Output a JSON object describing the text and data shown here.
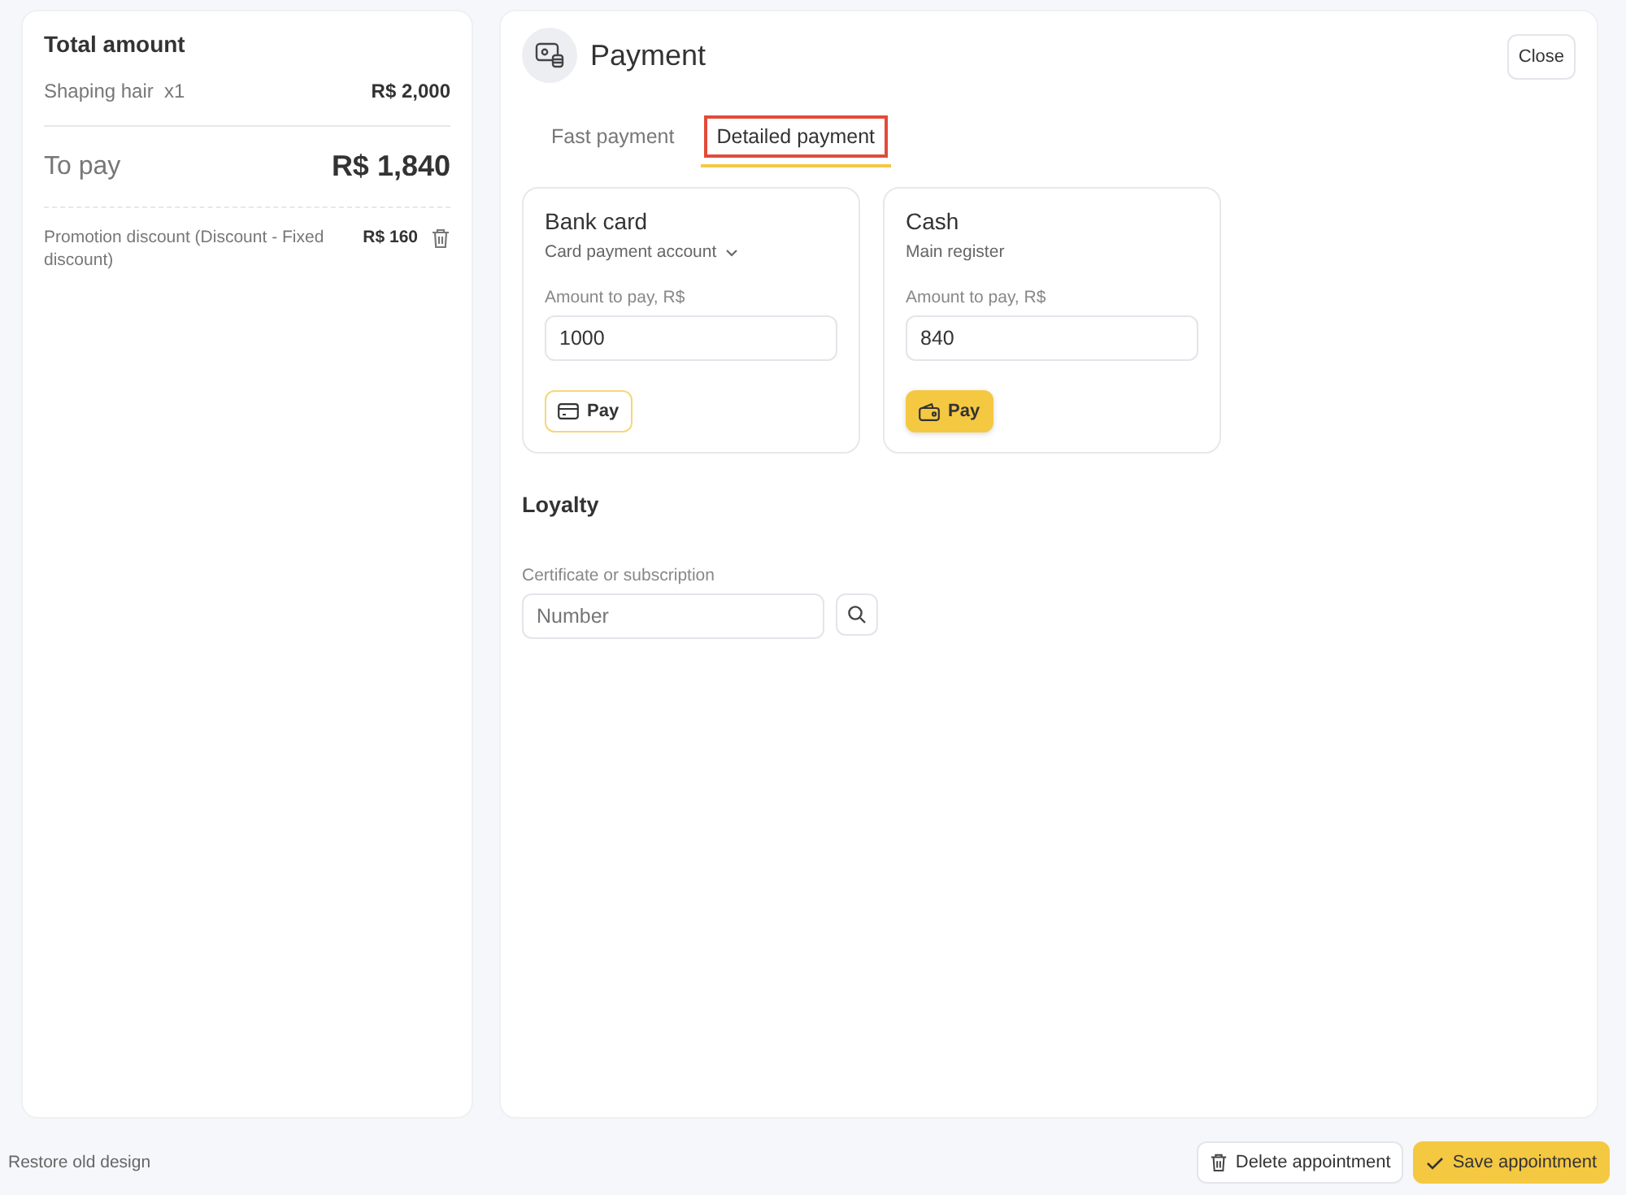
{
  "summary": {
    "title": "Total amount",
    "items": [
      {
        "name": "Shaping hair  x1",
        "amount": "R$ 2,000"
      }
    ],
    "to_pay_label": "To pay",
    "to_pay_amount": "R$ 1,840",
    "discounts": [
      {
        "name": "Promotion discount (Discount - Fixed discount)",
        "amount": "R$ 160"
      }
    ]
  },
  "payment": {
    "title": "Payment",
    "close": "Close",
    "tabs": [
      {
        "label": "Fast payment",
        "selected": false,
        "highlighted": false
      },
      {
        "label": "Detailed payment",
        "selected": true,
        "highlighted": true
      }
    ],
    "methods": [
      {
        "kind": "card",
        "title": "Bank card",
        "account": "Card payment account",
        "dropdown": true,
        "amount_label": "Amount to pay, R$",
        "amount": "1000",
        "button": "Pay",
        "primary": false
      },
      {
        "kind": "cash",
        "title": "Cash",
        "account": "Main register",
        "dropdown": false,
        "amount_label": "Amount to pay, R$",
        "amount": "840",
        "button": "Pay",
        "primary": true
      }
    ],
    "loyalty": {
      "title": "Loyalty",
      "label": "Certificate or subscription",
      "placeholder": "Number"
    }
  },
  "footer": {
    "restore": "Restore old design",
    "delete": "Delete appointment",
    "save": "Save appointment"
  }
}
